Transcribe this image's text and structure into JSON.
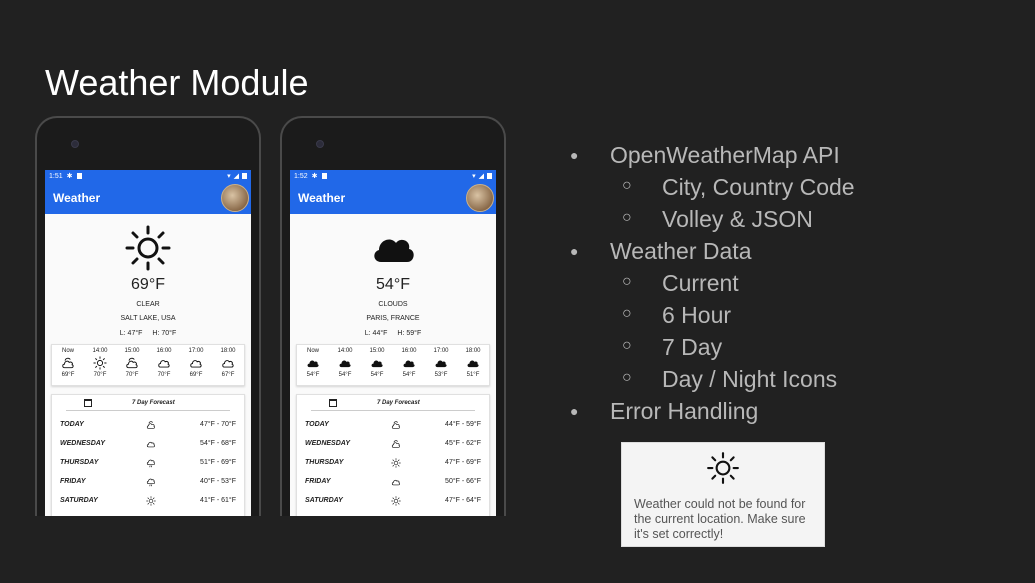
{
  "slide": {
    "title": "Weather Module"
  },
  "phones": [
    {
      "status_time": "1:51",
      "app_title": "Weather",
      "current": {
        "temp": "69°F",
        "condition": "CLEAR",
        "location": "SALT LAKE, USA",
        "low": "L: 47°F",
        "high": "H: 70°F",
        "icon": "sun-icon"
      },
      "hourly": [
        {
          "time": "Now",
          "temp": "69°F",
          "icon": "partly-cloudy-icon"
        },
        {
          "time": "14:00",
          "temp": "70°F",
          "icon": "sun-icon"
        },
        {
          "time": "15:00",
          "temp": "70°F",
          "icon": "partly-cloudy-icon"
        },
        {
          "time": "16:00",
          "temp": "70°F",
          "icon": "cloud-icon"
        },
        {
          "time": "17:00",
          "temp": "69°F",
          "icon": "cloud-icon"
        },
        {
          "time": "18:00",
          "temp": "67°F",
          "icon": "cloud-icon"
        }
      ],
      "daily_title": "7 Day Forecast",
      "daily": [
        {
          "day": "TODAY",
          "range": "47°F - 70°F",
          "icon": "partly-cloudy-icon"
        },
        {
          "day": "WEDNESDAY",
          "range": "54°F - 68°F",
          "icon": "cloud-icon"
        },
        {
          "day": "THURSDAY",
          "range": "51°F - 69°F",
          "icon": "rain-cloud-icon"
        },
        {
          "day": "FRIDAY",
          "range": "40°F - 53°F",
          "icon": "rain-cloud-icon"
        },
        {
          "day": "SATURDAY",
          "range": "41°F - 61°F",
          "icon": "sun-icon"
        }
      ]
    },
    {
      "status_time": "1:52",
      "app_title": "Weather",
      "current": {
        "temp": "54°F",
        "condition": "CLOUDS",
        "location": "PARIS, FRANCE",
        "low": "L: 44°F",
        "high": "H: 59°F",
        "icon": "cloud-filled-icon"
      },
      "hourly": [
        {
          "time": "Now",
          "temp": "54°F",
          "icon": "cloud-filled-icon"
        },
        {
          "time": "14:00",
          "temp": "54°F",
          "icon": "cloud-filled-icon"
        },
        {
          "time": "15:00",
          "temp": "54°F",
          "icon": "cloud-filled-icon"
        },
        {
          "time": "16:00",
          "temp": "54°F",
          "icon": "cloud-filled-icon"
        },
        {
          "time": "17:00",
          "temp": "53°F",
          "icon": "cloud-filled-icon"
        },
        {
          "time": "18:00",
          "temp": "51°F",
          "icon": "cloud-filled-icon"
        }
      ],
      "daily_title": "7 Day Forecast",
      "daily": [
        {
          "day": "TODAY",
          "range": "44°F - 59°F",
          "icon": "partly-cloudy-icon"
        },
        {
          "day": "WEDNESDAY",
          "range": "45°F - 62°F",
          "icon": "partly-cloudy-icon"
        },
        {
          "day": "THURSDAY",
          "range": "47°F - 69°F",
          "icon": "sun-icon"
        },
        {
          "day": "FRIDAY",
          "range": "50°F - 66°F",
          "icon": "cloud-icon"
        },
        {
          "day": "SATURDAY",
          "range": "47°F - 64°F",
          "icon": "sun-icon"
        }
      ]
    }
  ],
  "bullets": [
    {
      "level": 1,
      "text": "OpenWeatherMap API"
    },
    {
      "level": 2,
      "text": "City, Country Code"
    },
    {
      "level": 2,
      "text": "Volley & JSON"
    },
    {
      "level": 1,
      "text": "Weather Data"
    },
    {
      "level": 2,
      "text": "Current"
    },
    {
      "level": 2,
      "text": "6 Hour"
    },
    {
      "level": 2,
      "text": "7 Day"
    },
    {
      "level": 2,
      "text": "Day / Night Icons"
    },
    {
      "level": 1,
      "text": "Error Handling"
    }
  ],
  "error_card": {
    "icon": "sun-icon",
    "message": "Weather could not be found for the current location. Make sure it's set correctly!"
  }
}
